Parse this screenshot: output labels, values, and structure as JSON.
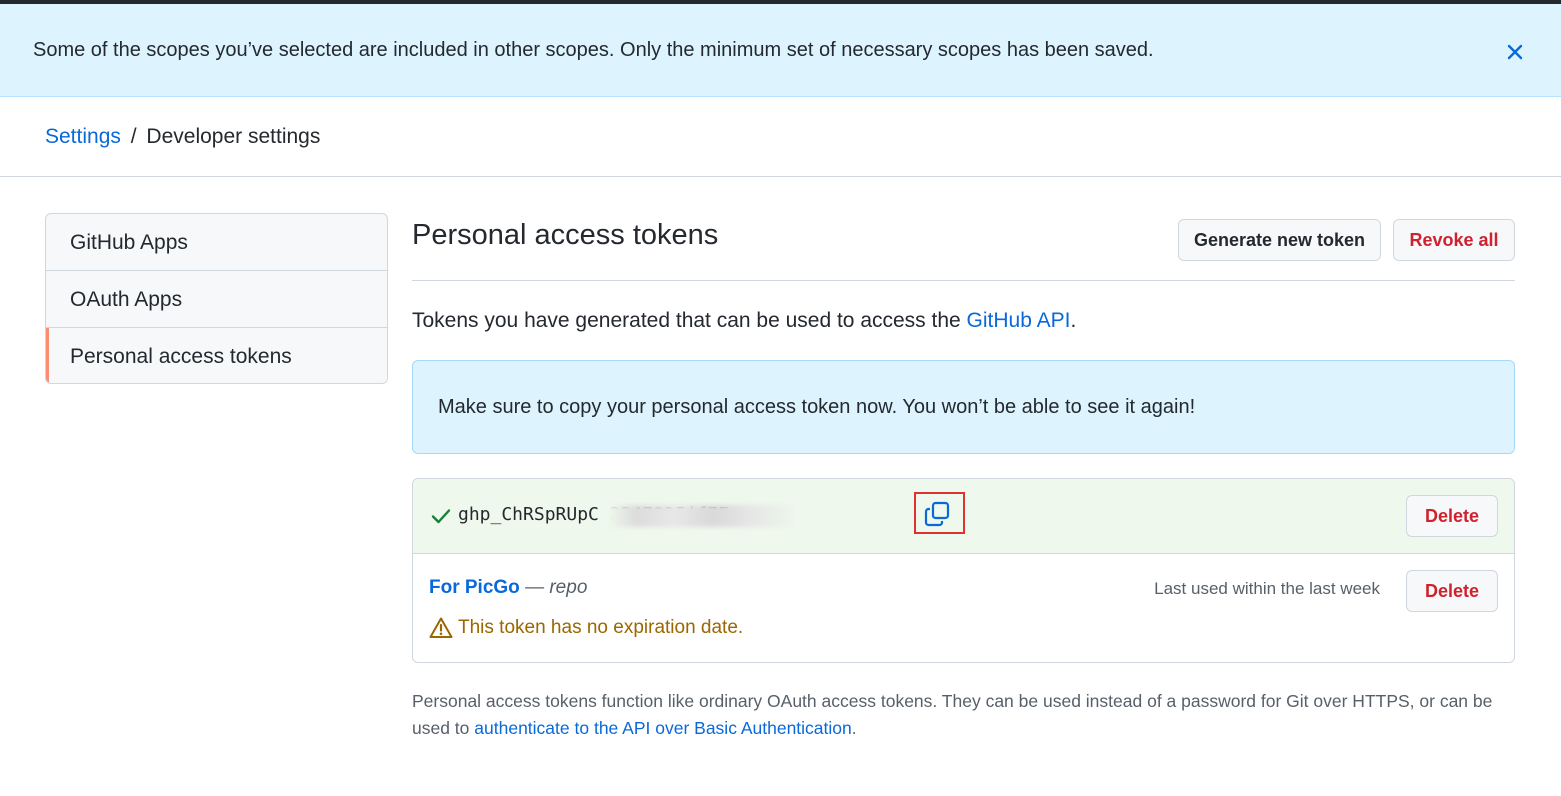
{
  "flash": {
    "message": "Some of the scopes you’ve selected are included in other scopes. Only the minimum set of necessary scopes has been saved.",
    "close_icon": "x-icon"
  },
  "breadcrumb": {
    "settings": "Settings",
    "separator": "/",
    "current": "Developer settings"
  },
  "sidebar": {
    "items": [
      {
        "label": "GitHub Apps",
        "selected": false
      },
      {
        "label": "OAuth Apps",
        "selected": false
      },
      {
        "label": "Personal access tokens",
        "selected": true
      }
    ]
  },
  "main": {
    "title": "Personal access tokens",
    "generate_label": "Generate new token",
    "revoke_label": "Revoke all",
    "desc_prefix": "Tokens you have generated that can be used to access the ",
    "desc_link": "GitHub API",
    "desc_suffix": ".",
    "notice": "Make sure to copy your personal access token now. You won’t be able to see it again!"
  },
  "new_token": {
    "value_visible": "ghp_ChRSpRUpC                  3B4783Ijf7E",
    "copy_icon": "copy-icon",
    "check_icon": "check-icon",
    "delete_label": "Delete"
  },
  "token": {
    "name": "For PicGo",
    "dash": " — ",
    "scope": "repo",
    "last_used": "Last used within the last week",
    "delete_label": "Delete",
    "warning": "This token has no expiration date.",
    "warning_icon": "alert-icon"
  },
  "footer": {
    "prefix": "Personal access tokens function like ordinary OAuth access tokens. They can be used instead of a password for Git over HTTPS, or can be used to ",
    "link": "authenticate to the API over Basic Authentication",
    "suffix": "."
  },
  "colors": {
    "link": "#0969da",
    "danger": "#cf222e",
    "flash_bg": "#ddf4ff",
    "new_token_bg": "#eef8ec",
    "warning": "#9a6700",
    "nav_selected_accent": "#fd8c73",
    "highlight_box": "#e03131"
  }
}
